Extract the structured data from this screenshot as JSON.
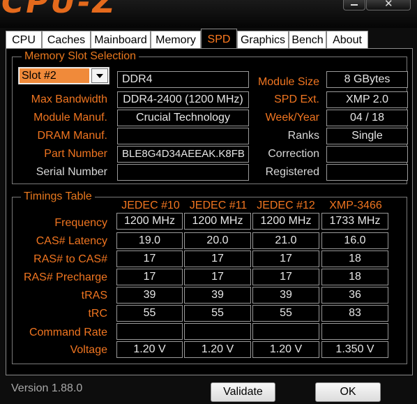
{
  "app": {
    "logo": "CPU-Z",
    "version": "Version 1.88.0"
  },
  "tabs": [
    "CPU",
    "Caches",
    "Mainboard",
    "Memory",
    "SPD",
    "Graphics",
    "Bench",
    "About"
  ],
  "active_tab": "SPD",
  "slot_selection": {
    "title": "Memory Slot Selection",
    "slot_value": "Slot #2",
    "memory_type": "DDR4",
    "labels": {
      "module_size": "Module Size",
      "max_bandwidth": "Max Bandwidth",
      "spd_ext": "SPD Ext.",
      "module_manuf": "Module Manuf.",
      "week_year": "Week/Year",
      "dram_manuf": "DRAM Manuf.",
      "ranks": "Ranks",
      "part_number": "Part Number",
      "correction": "Correction",
      "serial_number": "Serial Number",
      "registered": "Registered"
    },
    "values": {
      "module_size": "8 GBytes",
      "max_bandwidth": "DDR4-2400 (1200 MHz)",
      "spd_ext": "XMP 2.0",
      "module_manuf": "Crucial Technology",
      "week_year": "04 / 18",
      "dram_manuf": "",
      "ranks": "Single",
      "part_number": "BLE8G4D34AEEAK.K8FB",
      "correction": "",
      "serial_number": "",
      "registered": ""
    }
  },
  "timings": {
    "title": "Timings Table",
    "columns": [
      "JEDEC #10",
      "JEDEC #11",
      "JEDEC #12",
      "XMP-3466"
    ],
    "rows": [
      {
        "label": "Frequency",
        "values": [
          "1200 MHz",
          "1200 MHz",
          "1200 MHz",
          "1733 MHz"
        ]
      },
      {
        "label": "CAS# Latency",
        "values": [
          "19.0",
          "20.0",
          "21.0",
          "16.0"
        ]
      },
      {
        "label": "RAS# to CAS#",
        "values": [
          "17",
          "17",
          "17",
          "18"
        ]
      },
      {
        "label": "RAS# Precharge",
        "values": [
          "17",
          "17",
          "17",
          "18"
        ]
      },
      {
        "label": "tRAS",
        "values": [
          "39",
          "39",
          "39",
          "36"
        ]
      },
      {
        "label": "tRC",
        "values": [
          "55",
          "55",
          "55",
          "83"
        ]
      },
      {
        "label": "Command Rate",
        "values": [
          "",
          "",
          "",
          ""
        ]
      },
      {
        "label": "Voltage",
        "values": [
          "1.20 V",
          "1.20 V",
          "1.20 V",
          "1.350 V"
        ]
      }
    ]
  },
  "buttons": {
    "validate": "Validate",
    "ok": "OK"
  },
  "window_controls": {
    "close_glyph": "✕"
  },
  "colors": {
    "accent_orange": "#f07520",
    "selected_slot": "#f08a3a",
    "background": "#000000"
  }
}
